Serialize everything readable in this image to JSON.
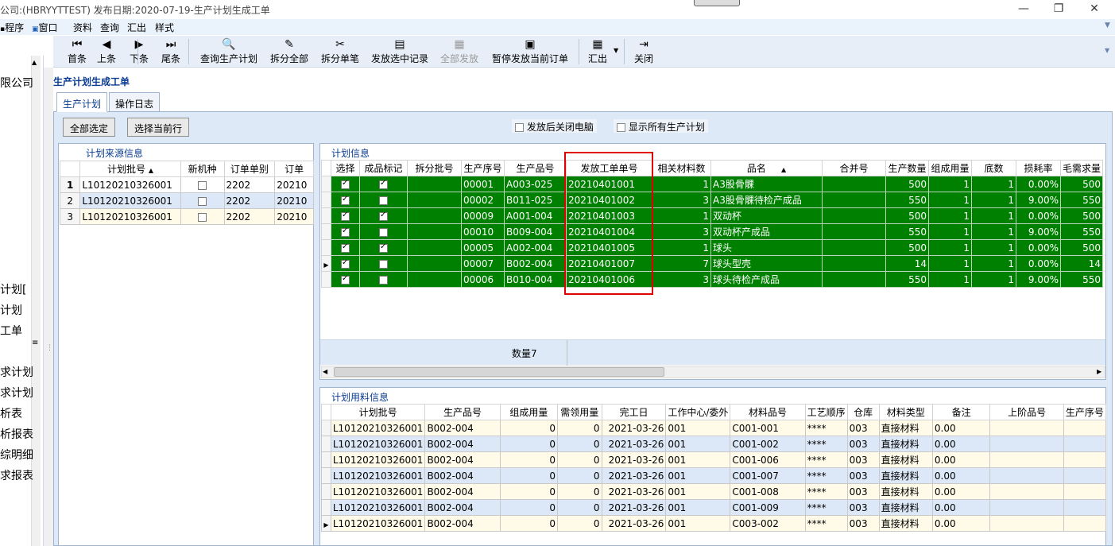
{
  "window": {
    "title": "公司:(HBRYYTTEST) 发布日期:2020-07-19-生产计划生成工单",
    "min": "—",
    "restore": "❐",
    "close": "✕"
  },
  "menu": [
    "程序",
    "窗口",
    "资料",
    "查询",
    "汇出",
    "样式"
  ],
  "toolbar": [
    {
      "label": "首条",
      "icon": "first-record-icon",
      "glyph": "⏮",
      "enabled": true
    },
    {
      "label": "上条",
      "icon": "prev-record-icon",
      "glyph": "◀",
      "enabled": true
    },
    {
      "label": "下条",
      "icon": "next-record-icon",
      "glyph": "▶",
      "enabled": true
    },
    {
      "label": "尾条",
      "icon": "last-record-icon",
      "glyph": "⏭",
      "enabled": true
    },
    {
      "label": "查询生产计划",
      "icon": "query-icon",
      "glyph": "🔍",
      "enabled": true
    },
    {
      "label": "拆分全部",
      "icon": "split-all-icon",
      "glyph": "✎",
      "enabled": true
    },
    {
      "label": "拆分单笔",
      "icon": "split-single-icon",
      "glyph": "✂",
      "enabled": true
    },
    {
      "label": "发放选中记录",
      "icon": "release-selected-icon",
      "glyph": "▤",
      "enabled": true
    },
    {
      "label": "全部发放",
      "icon": "release-all-icon",
      "glyph": "▦",
      "enabled": false
    },
    {
      "label": "暂停发放当前订单",
      "icon": "pause-release-icon",
      "glyph": "▣",
      "enabled": true
    },
    {
      "label": "汇出",
      "icon": "export-icon",
      "glyph": "▦",
      "enabled": true
    },
    {
      "label": "关闭",
      "icon": "close-door-icon",
      "glyph": "⇥",
      "enabled": true
    }
  ],
  "leftnav": [
    "限公司",
    "",
    "",
    "",
    "",
    "",
    "计划[",
    "计划",
    "工单",
    "",
    "",
    "求计划",
    "求计划",
    "析表",
    "析报表",
    "综明细",
    "求报表",
    "",
    "",
    ""
  ],
  "page_title": "生产计划生成工单",
  "tabs": [
    "生产计划",
    "操作日志"
  ],
  "buttons": {
    "select_all": "全部选定",
    "select_current": "选择当前行"
  },
  "checkboxes": {
    "close_after": "发放后关闭电脑",
    "show_all": "显示所有生产计划"
  },
  "source": {
    "title": "计划来源信息",
    "columns": [
      "",
      "计划批号",
      "新机种",
      "订单单别",
      "订单"
    ],
    "rows": [
      {
        "n": "1",
        "batch": "L10120210326001",
        "new": false,
        "type": "2202",
        "order": "20210"
      },
      {
        "n": "2",
        "batch": "L10120210326001",
        "new": false,
        "type": "2202",
        "order": "20210"
      },
      {
        "n": "3",
        "batch": "L10120210326001",
        "new": false,
        "type": "2202",
        "order": "20210"
      }
    ]
  },
  "plan": {
    "title": "计划信息",
    "columns": [
      "",
      "选择",
      "成品标记",
      "拆分批号",
      "生产序号",
      "生产品号",
      "发放工单单号",
      "相关材料数",
      "品名",
      "合并号",
      "生产数量",
      "组成用量",
      "底数",
      "损耗率",
      "毛需求量"
    ],
    "rows": [
      {
        "sel": true,
        "fin": true,
        "split": "",
        "seq": "00001",
        "item": "A003-025",
        "wo": "20210401001",
        "mat": "1",
        "name": "A3股骨髁",
        "merge": "",
        "qty": "500",
        "use": "1",
        "base": "1",
        "loss": "0.00%",
        "gross": "500"
      },
      {
        "sel": true,
        "fin": false,
        "split": "",
        "seq": "00002",
        "item": "B011-025",
        "wo": "20210401002",
        "mat": "3",
        "name": "A3股骨髁待检产成品",
        "merge": "",
        "qty": "550",
        "use": "1",
        "base": "1",
        "loss": "9.00%",
        "gross": "550"
      },
      {
        "sel": true,
        "fin": true,
        "split": "",
        "seq": "00009",
        "item": "A001-004",
        "wo": "20210401003",
        "mat": "1",
        "name": "双动杯",
        "merge": "",
        "qty": "500",
        "use": "1",
        "base": "1",
        "loss": "0.00%",
        "gross": "500"
      },
      {
        "sel": true,
        "fin": false,
        "split": "",
        "seq": "00010",
        "item": "B009-004",
        "wo": "20210401004",
        "mat": "3",
        "name": "双动杯产成品",
        "merge": "",
        "qty": "550",
        "use": "1",
        "base": "1",
        "loss": "9.00%",
        "gross": "550"
      },
      {
        "sel": true,
        "fin": true,
        "split": "",
        "seq": "00005",
        "item": "A002-004",
        "wo": "20210401005",
        "mat": "1",
        "name": "球头",
        "merge": "",
        "qty": "500",
        "use": "1",
        "base": "1",
        "loss": "0.00%",
        "gross": "500"
      },
      {
        "sel": true,
        "fin": false,
        "split": "",
        "seq": "00007",
        "item": "B002-004",
        "wo": "20210401007",
        "mat": "7",
        "name": "球头型壳",
        "merge": "",
        "qty": "14",
        "use": "1",
        "base": "1",
        "loss": "0.00%",
        "gross": "14"
      },
      {
        "sel": true,
        "fin": false,
        "split": "",
        "seq": "00006",
        "item": "B010-004",
        "wo": "20210401006",
        "mat": "3",
        "name": "球头待检产成品",
        "merge": "",
        "qty": "550",
        "use": "1",
        "base": "1",
        "loss": "9.00%",
        "gross": "550"
      }
    ],
    "count_label": "数量7"
  },
  "material": {
    "title": "计划用料信息",
    "columns": [
      "",
      "计划批号",
      "生产品号",
      "组成用量",
      "需领用量",
      "完工日",
      "工作中心/委外",
      "材料品号",
      "工艺顺序",
      "仓库",
      "材料类型",
      "备注",
      "上阶品号",
      "生产序号"
    ],
    "rows": [
      {
        "batch": "L10120210326001",
        "item": "B002-004",
        "use": "0",
        "need": "0",
        "date": "2021-03-26",
        "wc": "001",
        "mat": "C001-001",
        "op": "****",
        "wh": "003",
        "type": "直接材料",
        "note": "0.00"
      },
      {
        "batch": "L10120210326001",
        "item": "B002-004",
        "use": "0",
        "need": "0",
        "date": "2021-03-26",
        "wc": "001",
        "mat": "C001-002",
        "op": "****",
        "wh": "003",
        "type": "直接材料",
        "note": "0.00"
      },
      {
        "batch": "L10120210326001",
        "item": "B002-004",
        "use": "0",
        "need": "0",
        "date": "2021-03-26",
        "wc": "001",
        "mat": "C001-006",
        "op": "****",
        "wh": "003",
        "type": "直接材料",
        "note": "0.00"
      },
      {
        "batch": "L10120210326001",
        "item": "B002-004",
        "use": "0",
        "need": "0",
        "date": "2021-03-26",
        "wc": "001",
        "mat": "C001-007",
        "op": "****",
        "wh": "003",
        "type": "直接材料",
        "note": "0.00"
      },
      {
        "batch": "L10120210326001",
        "item": "B002-004",
        "use": "0",
        "need": "0",
        "date": "2021-03-26",
        "wc": "001",
        "mat": "C001-008",
        "op": "****",
        "wh": "003",
        "type": "直接材料",
        "note": "0.00"
      },
      {
        "batch": "L10120210326001",
        "item": "B002-004",
        "use": "0",
        "need": "0",
        "date": "2021-03-26",
        "wc": "001",
        "mat": "C001-009",
        "op": "****",
        "wh": "003",
        "type": "直接材料",
        "note": "0.00"
      },
      {
        "batch": "L10120210326001",
        "item": "B002-004",
        "use": "0",
        "need": "0",
        "date": "2021-03-26",
        "wc": "001",
        "mat": "C003-002",
        "op": "****",
        "wh": "003",
        "type": "直接材料",
        "note": "0.00"
      }
    ]
  }
}
